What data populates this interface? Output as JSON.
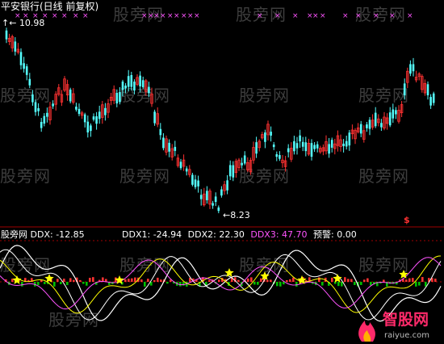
{
  "window": {
    "title": "平安银行(日线 前复权)"
  },
  "price_panel": {
    "high_marker": "10.98",
    "low_marker": "8.23",
    "signal_glyph": "$"
  },
  "indicator_panel": {
    "name": "股旁网",
    "ddx_label": "DDX:",
    "ddx_value": "-12.85",
    "ddx1_label": "DDX1:",
    "ddx1_value": "-24.94",
    "ddx2_label": "DDX2:",
    "ddx2_value": "22.30",
    "ddx3_label": "DDX3:",
    "ddx3_value": "47.70",
    "warn_label": "预警:",
    "warn_value": "0.00"
  },
  "watermarks": [
    "股旁网",
    "股旁网",
    "股旁网",
    "股旁网",
    "股旁网",
    "股旁网",
    "股旁网",
    "股旁网",
    "股旁网",
    "股旁网",
    "股旁网",
    "股旁网",
    "股旁网",
    "股旁网",
    "股旁网",
    "股旁网"
  ],
  "logo": {
    "name": "智股网",
    "url": "raiyue.com"
  },
  "colors": {
    "up": "#ff3232",
    "down": "#54fcfc",
    "white": "#ffffff",
    "yellow": "#ffff00",
    "magenta": "#ff54ff",
    "green": "#00c000",
    "grid": "#a00000"
  },
  "chart_data": {
    "type": "candlestick",
    "labeled_prices": {
      "high": 10.98,
      "low": 8.23
    },
    "indicator_readout": {
      "DDX": -12.85,
      "DDX1": -24.94,
      "DDX2": 22.3,
      "DDX3": 47.7,
      "warning": 0.0
    }
  }
}
